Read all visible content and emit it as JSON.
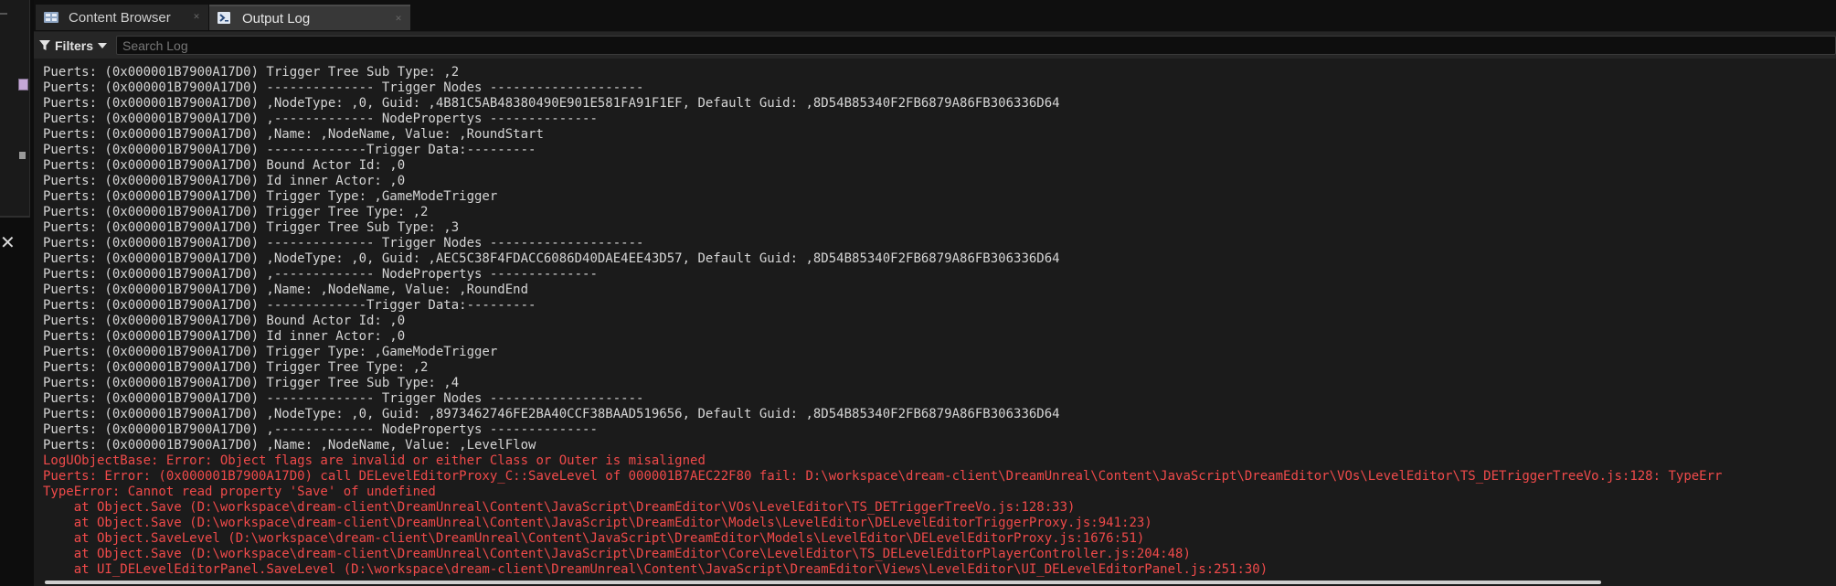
{
  "tabs": [
    {
      "label": "Content Browser",
      "icon": "content-browser-icon",
      "active": false
    },
    {
      "label": "Output Log",
      "icon": "output-log-icon",
      "active": true
    }
  ],
  "toolbar": {
    "filters_label": "Filters",
    "search_placeholder": "Search Log",
    "search_value": ""
  },
  "log": {
    "lines": [
      {
        "text": "Puerts: (0x000001B7900A17D0) Trigger Tree Sub Type: ,2",
        "level": "info"
      },
      {
        "text": "Puerts: (0x000001B7900A17D0) -------------- Trigger Nodes --------------------",
        "level": "info"
      },
      {
        "text": "Puerts: (0x000001B7900A17D0) ,NodeType: ,0, Guid: ,4B81C5AB48380490E901E581FA91F1EF, Default Guid: ,8D54B85340F2FB6879A86FB306336D64",
        "level": "info"
      },
      {
        "text": "Puerts: (0x000001B7900A17D0) ,------------- NodePropertys --------------",
        "level": "info"
      },
      {
        "text": "Puerts: (0x000001B7900A17D0) ,Name: ,NodeName, Value: ,RoundStart",
        "level": "info"
      },
      {
        "text": "Puerts: (0x000001B7900A17D0) -------------Trigger Data:---------",
        "level": "info"
      },
      {
        "text": "Puerts: (0x000001B7900A17D0) Bound Actor Id: ,0",
        "level": "info"
      },
      {
        "text": "Puerts: (0x000001B7900A17D0) Id inner Actor: ,0",
        "level": "info"
      },
      {
        "text": "Puerts: (0x000001B7900A17D0) Trigger Type: ,GameModeTrigger",
        "level": "info"
      },
      {
        "text": "Puerts: (0x000001B7900A17D0) Trigger Tree Type: ,2",
        "level": "info"
      },
      {
        "text": "Puerts: (0x000001B7900A17D0) Trigger Tree Sub Type: ,3",
        "level": "info"
      },
      {
        "text": "Puerts: (0x000001B7900A17D0) -------------- Trigger Nodes --------------------",
        "level": "info"
      },
      {
        "text": "Puerts: (0x000001B7900A17D0) ,NodeType: ,0, Guid: ,AEC5C38F4FDACC6086D40DAE4EE43D57, Default Guid: ,8D54B85340F2FB6879A86FB306336D64",
        "level": "info"
      },
      {
        "text": "Puerts: (0x000001B7900A17D0) ,------------- NodePropertys --------------",
        "level": "info"
      },
      {
        "text": "Puerts: (0x000001B7900A17D0) ,Name: ,NodeName, Value: ,RoundEnd",
        "level": "info"
      },
      {
        "text": "Puerts: (0x000001B7900A17D0) -------------Trigger Data:---------",
        "level": "info"
      },
      {
        "text": "Puerts: (0x000001B7900A17D0) Bound Actor Id: ,0",
        "level": "info"
      },
      {
        "text": "Puerts: (0x000001B7900A17D0) Id inner Actor: ,0",
        "level": "info"
      },
      {
        "text": "Puerts: (0x000001B7900A17D0) Trigger Type: ,GameModeTrigger",
        "level": "info"
      },
      {
        "text": "Puerts: (0x000001B7900A17D0) Trigger Tree Type: ,2",
        "level": "info"
      },
      {
        "text": "Puerts: (0x000001B7900A17D0) Trigger Tree Sub Type: ,4",
        "level": "info"
      },
      {
        "text": "Puerts: (0x000001B7900A17D0) -------------- Trigger Nodes --------------------",
        "level": "info"
      },
      {
        "text": "Puerts: (0x000001B7900A17D0) ,NodeType: ,0, Guid: ,8973462746FE2BA40CCF38BAAD519656, Default Guid: ,8D54B85340F2FB6879A86FB306336D64",
        "level": "info"
      },
      {
        "text": "Puerts: (0x000001B7900A17D0) ,------------- NodePropertys --------------",
        "level": "info"
      },
      {
        "text": "Puerts: (0x000001B7900A17D0) ,Name: ,NodeName, Value: ,LevelFlow",
        "level": "info"
      },
      {
        "text": "LogUObjectBase: Error: Object flags are invalid or either Class or Outer is misaligned",
        "level": "error"
      },
      {
        "text": "Puerts: Error: (0x000001B7900A17D0) call DELevelEditorProxy_C::SaveLevel of 000001B7AEC22F80 fail: D:\\workspace\\dream-client\\DreamUnreal\\Content\\JavaScript\\DreamEditor\\VOs\\LevelEditor\\TS_DETriggerTreeVo.js:128: TypeErr",
        "level": "error"
      },
      {
        "text": "TypeError: Cannot read property 'Save' of undefined",
        "level": "error"
      },
      {
        "text": "    at Object.Save (D:\\workspace\\dream-client\\DreamUnreal\\Content\\JavaScript\\DreamEditor\\VOs\\LevelEditor\\TS_DETriggerTreeVo.js:128:33)",
        "level": "error"
      },
      {
        "text": "    at Object.Save (D:\\workspace\\dream-client\\DreamUnreal\\Content\\JavaScript\\DreamEditor\\Models\\LevelEditor\\DELevelEditorTriggerProxy.js:941:23)",
        "level": "error"
      },
      {
        "text": "    at Object.SaveLevel (D:\\workspace\\dream-client\\DreamUnreal\\Content\\JavaScript\\DreamEditor\\Models\\LevelEditor\\DELevelEditorProxy.js:1676:51)",
        "level": "error"
      },
      {
        "text": "    at Object.Save (D:\\workspace\\dream-client\\DreamUnreal\\Content\\JavaScript\\DreamEditor\\Core\\LevelEditor\\TS_DELevelEditorPlayerController.js:204:48)",
        "level": "error"
      },
      {
        "text": "    at UI_DELevelEditorPanel.SaveLevel (D:\\workspace\\dream-client\\DreamUnreal\\Content\\JavaScript\\DreamEditor\\Views\\LevelEditor\\UI_DELevelEditorPanel.js:251:30)",
        "level": "error"
      }
    ]
  },
  "colors": {
    "info_text": "#d5d5d5",
    "error_text": "#f04a4a",
    "log_background": "#1b1b1b"
  }
}
